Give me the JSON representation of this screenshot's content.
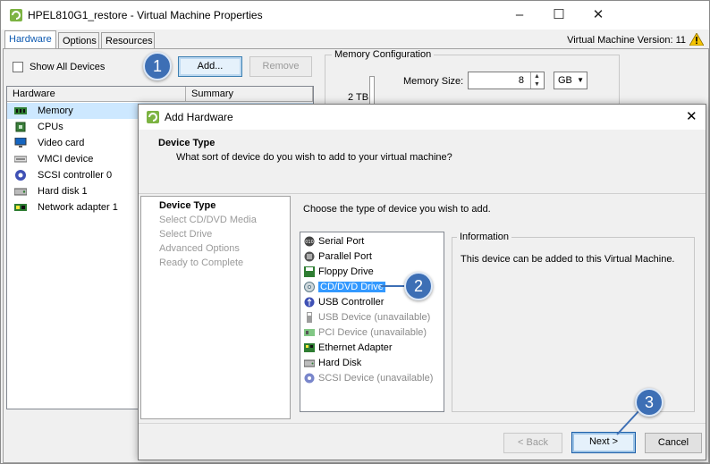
{
  "back_window": {
    "title": "HPEL810G1_restore - Virtual Machine Properties",
    "tabs": [
      "Hardware",
      "Options",
      "Resources"
    ],
    "vm_version": "Virtual Machine Version: 11",
    "show_all_devices": "Show All Devices",
    "add_button": "Add...",
    "remove_button": "Remove",
    "columns": [
      "Hardware",
      "Summary"
    ],
    "hardware_items": [
      {
        "label": "Memory",
        "icon": "memory-icon",
        "selected": true
      },
      {
        "label": "CPUs",
        "icon": "cpu-icon"
      },
      {
        "label": "Video card",
        "icon": "monitor-icon"
      },
      {
        "label": "VMCI device",
        "icon": "vmci-icon"
      },
      {
        "label": "SCSI controller 0",
        "icon": "scsi-icon"
      },
      {
        "label": "Hard disk 1",
        "icon": "disk-icon"
      },
      {
        "label": "Network adapter 1",
        "icon": "network-icon"
      }
    ],
    "memory_config": {
      "title": "Memory Configuration",
      "size_label": "Memory Size:",
      "size_value": "8",
      "unit": "GB",
      "scale_top": "2 TB"
    }
  },
  "dialog": {
    "title": "Add Hardware",
    "heading": "Device Type",
    "subheading": "What sort of device do you wish to add to your virtual machine?",
    "steps": [
      "Device Type",
      "Select CD/DVD Media",
      "Select Drive",
      "Advanced Options",
      "Ready to Complete"
    ],
    "prompt": "Choose the type of device you wish to add.",
    "devices": [
      {
        "label": "Serial Port",
        "icon": "serial-port-icon",
        "available": true
      },
      {
        "label": "Parallel Port",
        "icon": "parallel-port-icon",
        "available": true
      },
      {
        "label": "Floppy Drive",
        "icon": "floppy-icon",
        "available": true
      },
      {
        "label": "CD/DVD Drive",
        "icon": "cd-dvd-icon",
        "available": true,
        "selected": true
      },
      {
        "label": "USB Controller",
        "icon": "usb-icon",
        "available": true
      },
      {
        "label": "USB Device (unavailable)",
        "icon": "usb-device-icon",
        "available": false
      },
      {
        "label": "PCI Device (unavailable)",
        "icon": "pci-icon",
        "available": false
      },
      {
        "label": "Ethernet Adapter",
        "icon": "ethernet-icon",
        "available": true
      },
      {
        "label": "Hard Disk",
        "icon": "hard-disk-icon",
        "available": true
      },
      {
        "label": "SCSI Device (unavailable)",
        "icon": "scsi-device-icon",
        "available": false
      }
    ],
    "info_title": "Information",
    "info_text": "This device can be added to this Virtual Machine.",
    "back_button": "< Back",
    "next_button": "Next >",
    "cancel_button": "Cancel"
  },
  "callouts": [
    "1",
    "2",
    "3"
  ],
  "colors": {
    "accent": "#3d6fb5",
    "selection": "#3399ff",
    "tab_active_text": "#0d59b0"
  }
}
